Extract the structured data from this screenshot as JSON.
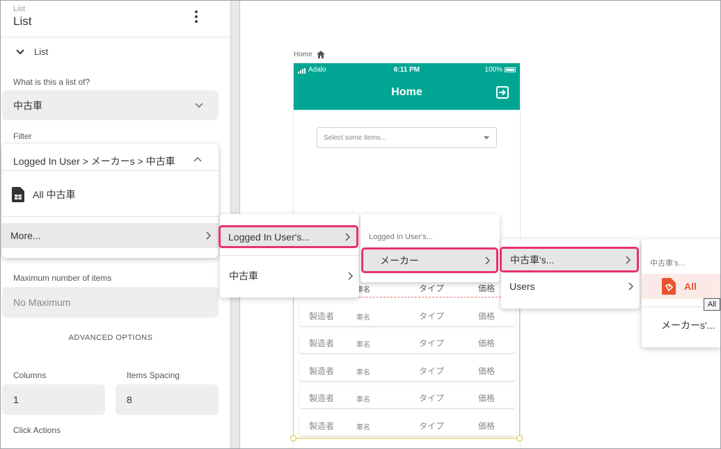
{
  "panel": {
    "header_small": "List",
    "header_title": "List",
    "section_label": "List",
    "list_of_label": "What is this a list of?",
    "list_of_value": "中古車",
    "filter_label": "Filter",
    "filter_path": "Logged In User > メーカーs > 中古車",
    "filter_all": "All 中古車",
    "filter_more": "More...",
    "max_items_label": "Maximum number of items",
    "max_items_value": "No Maximum",
    "advanced": "ADVANCED OPTIONS",
    "columns_label": "Columns",
    "columns_value": "1",
    "spacing_label": "Items Spacing",
    "spacing_value": "8",
    "click_actions_label": "Click Actions"
  },
  "canvas": {
    "breadcrumb": "Home",
    "status_carrier": "Adalo",
    "status_time": "6:11 PM",
    "status_battery": "100%",
    "screen_title": "Home",
    "select_placeholder": "Select some items...",
    "header_row": {
      "c2": "車名",
      "c3": "タイプ",
      "c4": "価格"
    },
    "rows": [
      {
        "c1": "製造者",
        "c2": "車名",
        "c3": "タイプ",
        "c4": "価格"
      },
      {
        "c1": "製造者",
        "c2": "車名",
        "c3": "タイプ",
        "c4": "価格"
      },
      {
        "c1": "製造者",
        "c2": "車名",
        "c3": "タイプ",
        "c4": "価格"
      },
      {
        "c1": "製造者",
        "c2": "車名",
        "c3": "タイプ",
        "c4": "価格"
      },
      {
        "c1": "製造者",
        "c2": "車名",
        "c3": "タイプ",
        "c4": "価格"
      }
    ]
  },
  "menus": {
    "m1": {
      "item1": "Logged In User's...",
      "item2": "中古車"
    },
    "m2": {
      "heading": "Logged In User's...",
      "item1": "メーカー"
    },
    "m3": {
      "item1": "中古車's...",
      "item2": "Users"
    },
    "m4": {
      "heading": "中古車's...",
      "item1": "All",
      "item2": "メーカーs'...",
      "tooltip": "All"
    }
  },
  "colors": {
    "brand": "#00a693",
    "highlight": "#e8336a",
    "all_item": "#e8522f"
  }
}
